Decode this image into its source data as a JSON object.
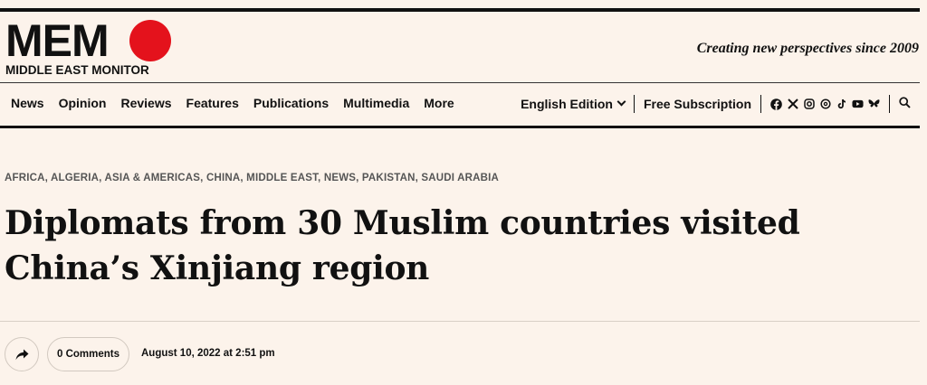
{
  "logo": {
    "word": "MEM",
    "sub": "MIDDLE EAST MONITOR"
  },
  "tagline": "Creating new perspectives since 2009",
  "nav": [
    "News",
    "Opinion",
    "Reviews",
    "Features",
    "Publications",
    "Multimedia",
    "More"
  ],
  "edition": "English Edition",
  "subscription": "Free Subscription",
  "social_icons": [
    "facebook-icon",
    "x-icon",
    "instagram-icon",
    "threads-icon",
    "tiktok-icon",
    "youtube-icon",
    "bluesky-icon"
  ],
  "categories": "AFRICA, ALGERIA, ASIA & AMERICAS, CHINA, MIDDLE EAST, NEWS, PAKISTAN, SAUDI ARABIA",
  "article": {
    "title": "Diplomats from 30 Muslim countries visited China’s Xinjiang region",
    "comments": "0 Comments",
    "date": "August 10, 2022 at 2:51 pm"
  },
  "colors": {
    "brand_red": "#e4121c",
    "background": "#fcf3eb"
  }
}
